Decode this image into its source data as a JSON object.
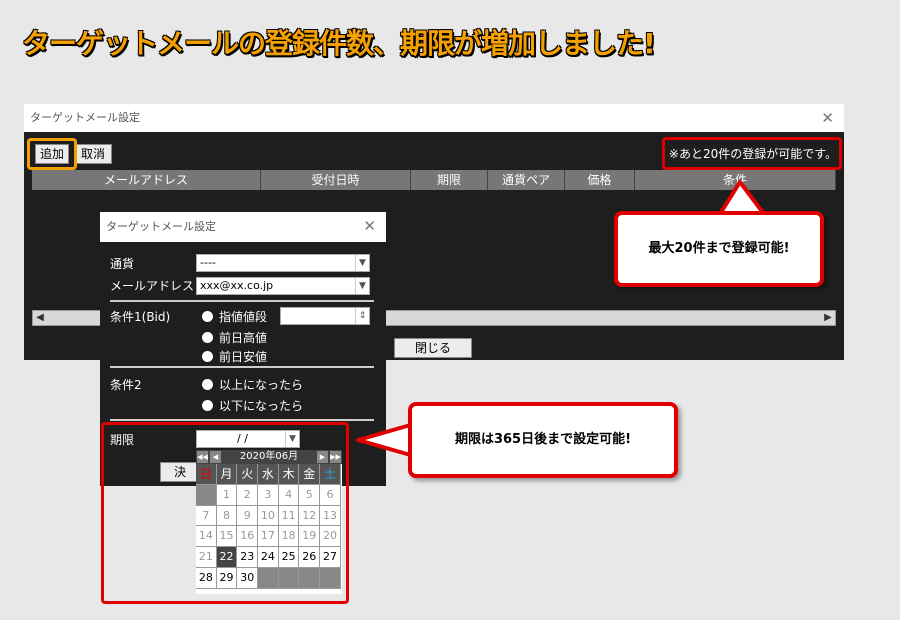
{
  "headline": "ターゲットメールの登録件数、期限が増加しました!",
  "main_window": {
    "title": "ターゲットメール設定",
    "add_label": "追加",
    "cancel_label": "取消",
    "notice": "※あと20件の登録が可能です。",
    "columns": [
      "メールアドレス",
      "受付日時",
      "期限",
      "通貨ペア",
      "価格",
      "条件"
    ],
    "close_label": "閉じる"
  },
  "dialog": {
    "title": "ターゲットメール設定",
    "currency_label": "通貨",
    "currency_value": "----",
    "email_label": "メールアドレス",
    "email_value": "xxx@xx.co.jp",
    "cond1_label": "条件1(Bid)",
    "cond1_options": [
      "指値値段",
      "前日高値",
      "前日安値"
    ],
    "cond2_label": "条件2",
    "cond2_options": [
      "以上になったら",
      "以下になったら"
    ],
    "expiry_label": "期限",
    "expiry_value": "/ /",
    "ok_label": "決"
  },
  "calendar": {
    "month": "2020年06月",
    "weekdays": [
      "日",
      "月",
      "火",
      "水",
      "木",
      "金",
      "土"
    ],
    "weekday_colors": [
      "#e00000",
      "#ffffff",
      "#ffffff",
      "#ffffff",
      "#ffffff",
      "#ffffff",
      "#29a3e0"
    ],
    "dim_days": [
      "1",
      "2",
      "3",
      "4",
      "5",
      "6",
      "7",
      "8",
      "9",
      "10",
      "11",
      "12",
      "13",
      "14",
      "15",
      "16",
      "17",
      "18",
      "19",
      "20",
      "21"
    ],
    "active_days": [
      "22",
      "23",
      "24",
      "25",
      "26",
      "27",
      "28",
      "29",
      "30"
    ],
    "today": "22"
  },
  "callouts": {
    "limit": "最大20件まで登録可能!",
    "expiry": "期限は365日後まで設定可能!"
  },
  "colors": {
    "accent_orange": "#f5a000",
    "accent_red": "#e00000"
  }
}
